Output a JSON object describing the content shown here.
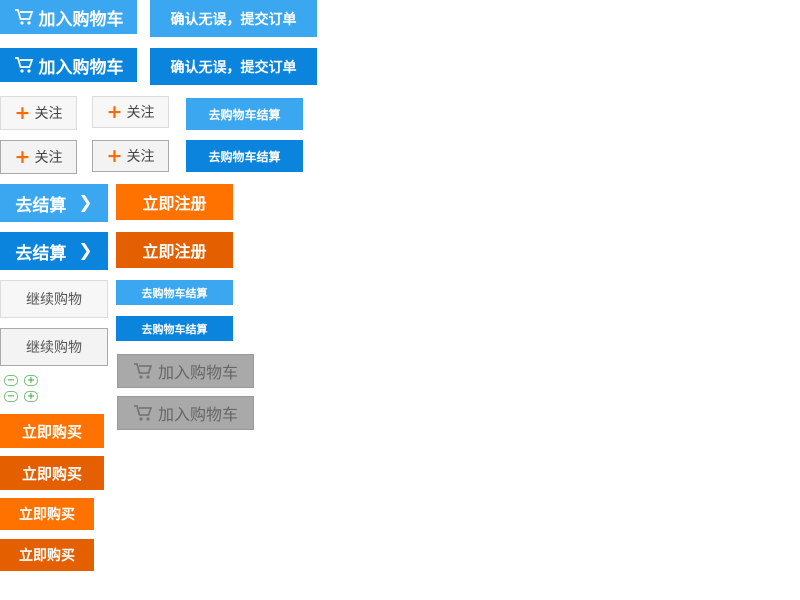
{
  "colors": {
    "blue_light": "#3aa7f0",
    "blue_dark": "#0a84dc",
    "orange_light": "#ff7200",
    "orange_dark": "#e35f00",
    "plus_orange": "#ff6a00",
    "disabled_gray": "#a9a9a9"
  },
  "add_to_cart": "加入购物车",
  "confirm_order": "确认无误，提交订单",
  "follow": "关注",
  "go_cart_checkout": "去购物车结算",
  "checkout": "去结算",
  "checkout_arrow": "❯",
  "register_now": "立即注册",
  "continue_shopping": "继续购物",
  "buy_now": "立即购买",
  "stepper": {
    "minus": "−",
    "plus": "+"
  },
  "icons": {
    "cart": "cart-icon",
    "plus": "plus-icon",
    "arrow": "chevron-right-icon"
  }
}
